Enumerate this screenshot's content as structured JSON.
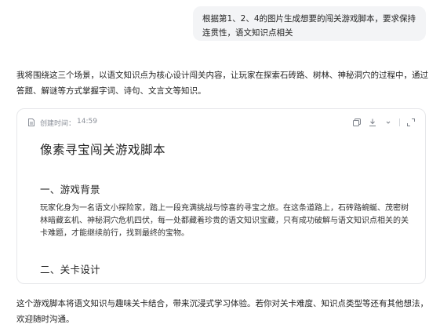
{
  "user_message": "根据第1、2、4的图片生成想要的闯关游戏脚本，要求保持连贯性，语文知识点相关",
  "assistant": {
    "intro": "我将围绕这三个场景，以语文知识点为核心设计闯关内容，让玩家在探索石砖路、树林、神秘洞穴的过程中，通过答题、解谜等方式掌握字词、诗句、文言文等知识。",
    "document": {
      "created_label": "创建时间：",
      "created_time": "14:59",
      "actions": [
        "copy-icon",
        "download-icon",
        "chevron-down-icon",
        "expand-icon"
      ],
      "title": "像素寻宝闯关游戏脚本",
      "section1_heading": "一、游戏背景",
      "section1_body": "玩家化身为一名语文小探险家，踏上一段充满挑战与惊喜的寻宝之旅。在这条道路上，石砖路蜿蜒、茂密树林暗藏玄机、神秘洞穴危机四伏，每一处都藏着珍贵的语文知识宝藏，只有成功破解与语文知识点相关的关卡难题，才能继续前行，找到最终的宝物。",
      "section2_heading": "二、关卡设计"
    },
    "outro": "这个游戏脚本将语文知识与趣味关卡结合，带来沉浸式学习体验。若你对关卡难度、知识点类型等还有其他想法，欢迎随时沟通。"
  }
}
